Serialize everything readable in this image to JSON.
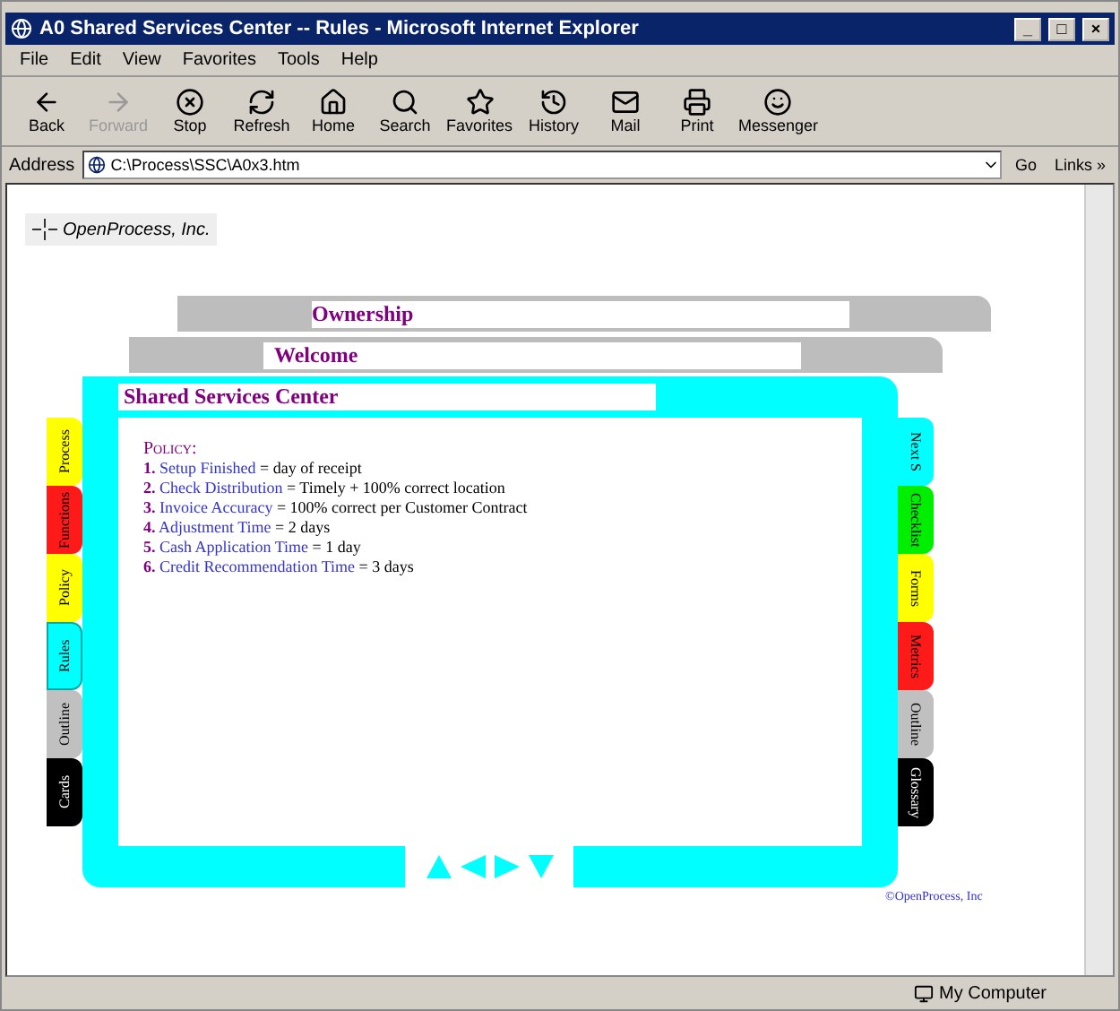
{
  "window": {
    "title": "A0 Shared Services Center -- Rules - Microsoft Internet Explorer",
    "controls": [
      "_",
      "□",
      "×"
    ]
  },
  "menu": [
    "File",
    "Edit",
    "View",
    "Favorites",
    "Tools",
    "Help"
  ],
  "toolbar": [
    {
      "kind": "back",
      "label": "Back",
      "disabled": false
    },
    {
      "kind": "forward",
      "label": "Forward",
      "disabled": true
    },
    {
      "kind": "stop",
      "label": "Stop",
      "disabled": false
    },
    {
      "kind": "refresh",
      "label": "Refresh",
      "disabled": false
    },
    {
      "kind": "home",
      "label": "Home",
      "disabled": false
    },
    {
      "kind": "search",
      "label": "Search",
      "disabled": false
    },
    {
      "kind": "favorites",
      "label": "Favorites",
      "disabled": false
    },
    {
      "kind": "history",
      "label": "History",
      "disabled": false
    },
    {
      "kind": "mail",
      "label": "Mail",
      "disabled": false
    },
    {
      "kind": "print",
      "label": "Print",
      "disabled": false
    },
    {
      "kind": "messenger",
      "label": "Messenger",
      "disabled": false
    }
  ],
  "address_bar": {
    "label": "Address",
    "value": "C:\\Process\\SSC\\A0x3.htm",
    "go": "Go",
    "links": "Links »"
  },
  "page": {
    "logo": "OpenProcess, Inc.",
    "stack": [
      {
        "title": "Ownership"
      },
      {
        "title": "Welcome"
      }
    ],
    "frame": {
      "title": "Shared Services Center",
      "left_tabs": [
        {
          "label": "Process",
          "color": "#ffff00",
          "selected": false
        },
        {
          "label": "Functions",
          "color": "#ff1a1a",
          "selected": false
        },
        {
          "label": "Policy",
          "color": "#ffff00",
          "selected": false
        },
        {
          "label": "Rules",
          "color": "#00ffff",
          "selected": true
        },
        {
          "label": "Outline",
          "color": "#c0c0c0",
          "selected": false
        },
        {
          "label": "Cards",
          "color": "#000000",
          "selected": false
        }
      ],
      "right_tabs": [
        {
          "label": "Next S",
          "color": "#00ffff"
        },
        {
          "label": "Checklist",
          "color": "#00ee00"
        },
        {
          "label": "Forms",
          "color": "#ffff00"
        },
        {
          "label": "Metrics",
          "color": "#ff1a1a"
        },
        {
          "label": "Outline",
          "color": "#c0c0c0"
        },
        {
          "label": "Glossary",
          "color": "#000000"
        }
      ],
      "heading": "Policy:",
      "rules": [
        {
          "number": "1.",
          "name": "Setup Finished",
          "value": "= day of receipt"
        },
        {
          "number": "2.",
          "name": "Check Distribution",
          "value": "= Timely + 100% correct location"
        },
        {
          "number": "3.",
          "name": "Invoice Accuracy",
          "value": "= 100% correct per Customer Contract"
        },
        {
          "number": "4.",
          "name": "Adjustment Time",
          "value": "= 2 days"
        },
        {
          "number": "5.",
          "name": "Cash Application Time",
          "value": "= 1 day"
        },
        {
          "number": "6.",
          "name": "Credit Recommendation Time",
          "value": "= 3 days"
        }
      ]
    },
    "copyright": "©OpenProcess, Inc"
  },
  "status_bar": {
    "zone": "My Computer"
  }
}
